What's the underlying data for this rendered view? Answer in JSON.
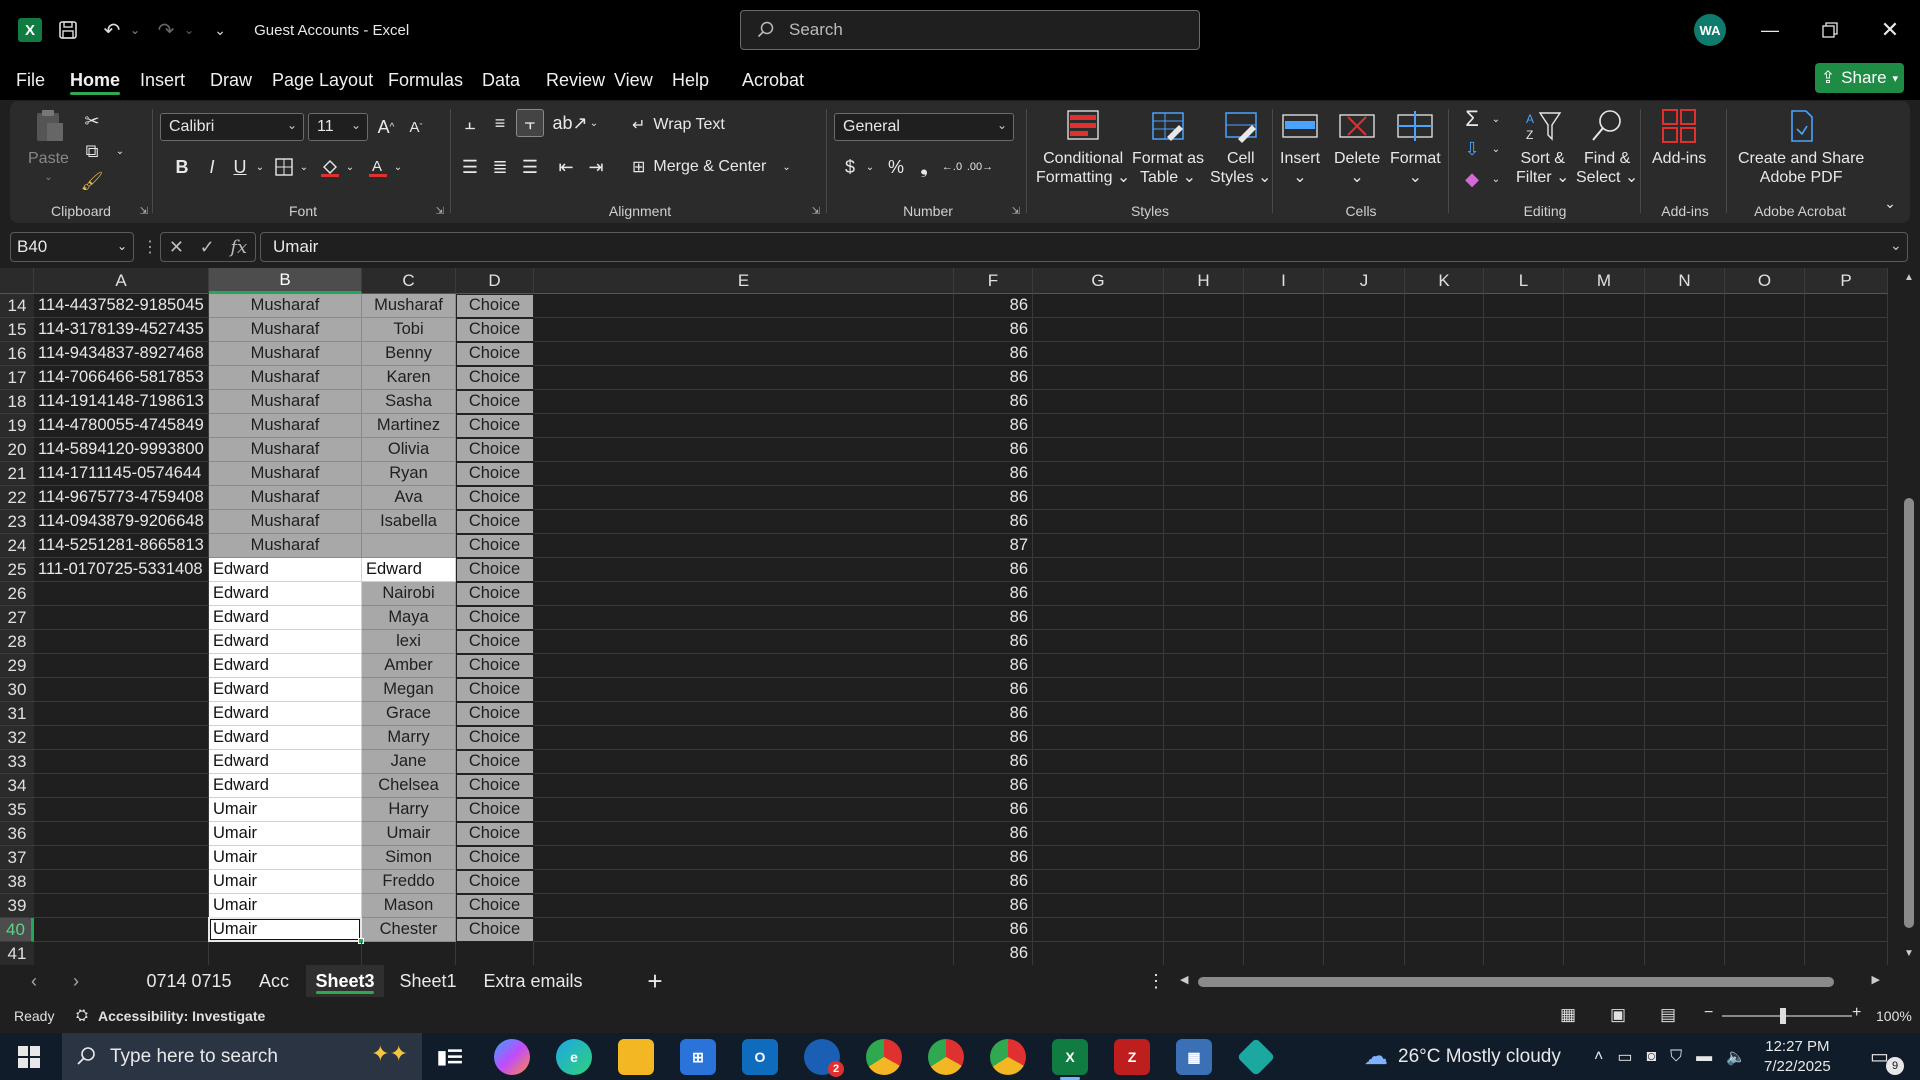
{
  "window": {
    "app": "Excel",
    "title": "Guest Accounts - Excel",
    "search_placeholder": "Search",
    "user_initials": "WA"
  },
  "menu": {
    "items": [
      "File",
      "Home",
      "Insert",
      "Draw",
      "Page Layout",
      "Formulas",
      "Data",
      "Review",
      "View",
      "Help",
      "Acrobat"
    ],
    "active": "Home",
    "share_label": "Share"
  },
  "ribbon": {
    "clipboard": {
      "label": "Clipboard",
      "paste": "Paste"
    },
    "font": {
      "label": "Font",
      "font_name": "Calibri",
      "font_size": "11"
    },
    "alignment": {
      "label": "Alignment",
      "wrap_text": "Wrap Text",
      "merge_center": "Merge & Center"
    },
    "number": {
      "label": "Number",
      "format": "General"
    },
    "styles": {
      "label": "Styles",
      "conditional_1": "Conditional",
      "conditional_2": "Formatting",
      "format_table_1": "Format as",
      "format_table_2": "Table",
      "cell_styles_1": "Cell",
      "cell_styles_2": "Styles"
    },
    "cells": {
      "label": "Cells",
      "insert": "Insert",
      "delete": "Delete",
      "format": "Format"
    },
    "editing": {
      "label": "Editing",
      "sort_1": "Sort &",
      "sort_2": "Filter",
      "find_1": "Find &",
      "find_2": "Select"
    },
    "addins": {
      "label": "Add-ins",
      "addins_btn": "Add-ins"
    },
    "acrobat": {
      "label": "Adobe Acrobat",
      "create_1": "Create and Share",
      "create_2": "Adobe PDF"
    }
  },
  "formula_bar": {
    "name_box": "B40",
    "content": "Umair"
  },
  "columns": [
    "A",
    "B",
    "C",
    "D",
    "E",
    "F",
    "G",
    "H",
    "I",
    "J",
    "K",
    "L",
    "M",
    "N",
    "O",
    "P"
  ],
  "selected_column": "B",
  "rows": [
    {
      "n": "14",
      "a": "114-4437582-9185045",
      "b": "Musharaf",
      "c": "Musharaf",
      "d": "Choice",
      "f": "86"
    },
    {
      "n": "15",
      "a": "114-3178139-4527435",
      "b": "Musharaf",
      "c": "Tobi",
      "d": "Choice",
      "f": "86"
    },
    {
      "n": "16",
      "a": "114-9434837-8927468",
      "b": "Musharaf",
      "c": "Benny",
      "d": "Choice",
      "f": "86"
    },
    {
      "n": "17",
      "a": "114-7066466-5817853",
      "b": "Musharaf",
      "c": "Karen",
      "d": "Choice",
      "f": "86"
    },
    {
      "n": "18",
      "a": "114-1914148-7198613",
      "b": "Musharaf",
      "c": "Sasha",
      "d": "Choice",
      "f": "86"
    },
    {
      "n": "19",
      "a": "114-4780055-4745849",
      "b": "Musharaf",
      "c": "Martinez",
      "d": "Choice",
      "f": "86"
    },
    {
      "n": "20",
      "a": "114-5894120-9993800",
      "b": "Musharaf",
      "c": "Olivia",
      "d": "Choice",
      "f": "86"
    },
    {
      "n": "21",
      "a": "114-1711145-0574644",
      "b": "Musharaf",
      "c": "Ryan",
      "d": "Choice",
      "f": "86"
    },
    {
      "n": "22",
      "a": "114-9675773-4759408",
      "b": "Musharaf",
      "c": "Ava",
      "d": "Choice",
      "f": "86"
    },
    {
      "n": "23",
      "a": "114-0943879-9206648",
      "b": "Musharaf",
      "c": "Isabella",
      "d": "Choice",
      "f": "86"
    },
    {
      "n": "24",
      "a": "114-5251281-8665813",
      "b": "Musharaf",
      "c": "",
      "d": "Choice",
      "f": "87"
    },
    {
      "n": "25",
      "a": "111-0170725-5331408",
      "b": "Edward",
      "c": "Edward",
      "d": "Choice",
      "f": "86"
    },
    {
      "n": "26",
      "a": "",
      "b": "Edward",
      "c": "Nairobi",
      "d": "Choice",
      "f": "86"
    },
    {
      "n": "27",
      "a": "",
      "b": "Edward",
      "c": "Maya",
      "d": "Choice",
      "f": "86"
    },
    {
      "n": "28",
      "a": "",
      "b": "Edward",
      "c": "lexi",
      "d": "Choice",
      "f": "86"
    },
    {
      "n": "29",
      "a": "",
      "b": "Edward",
      "c": "Amber",
      "d": "Choice",
      "f": "86"
    },
    {
      "n": "30",
      "a": "",
      "b": "Edward",
      "c": "Megan",
      "d": "Choice",
      "f": "86"
    },
    {
      "n": "31",
      "a": "",
      "b": "Edward",
      "c": "Grace",
      "d": "Choice",
      "f": "86"
    },
    {
      "n": "32",
      "a": "",
      "b": "Edward",
      "c": "Marry",
      "d": "Choice",
      "f": "86"
    },
    {
      "n": "33",
      "a": "",
      "b": "Edward",
      "c": "Jane",
      "d": "Choice",
      "f": "86"
    },
    {
      "n": "34",
      "a": "",
      "b": "Edward",
      "c": "Chelsea",
      "d": "Choice",
      "f": "86"
    },
    {
      "n": "35",
      "a": "",
      "b": "Umair",
      "c": "Harry",
      "d": "Choice",
      "f": "86"
    },
    {
      "n": "36",
      "a": "",
      "b": "Umair",
      "c": "Umair",
      "d": "Choice",
      "f": "86"
    },
    {
      "n": "37",
      "a": "",
      "b": "Umair",
      "c": "Simon",
      "d": "Choice",
      "f": "86"
    },
    {
      "n": "38",
      "a": "",
      "b": "Umair",
      "c": "Freddo",
      "d": "Choice",
      "f": "86"
    },
    {
      "n": "39",
      "a": "",
      "b": "Umair",
      "c": "Mason",
      "d": "Choice",
      "f": "86"
    },
    {
      "n": "40",
      "a": "",
      "b": "Umair",
      "c": "Chester",
      "d": "Choice",
      "f": "86"
    },
    {
      "n": "41",
      "a": "",
      "b": "",
      "c": "",
      "d": "",
      "f": "86"
    }
  ],
  "active_row": "40",
  "sheets": {
    "tabs": [
      "0714 0715",
      "Acc",
      "Sheet3",
      "Sheet1",
      "Extra emails"
    ],
    "active": "Sheet3"
  },
  "status": {
    "ready": "Ready",
    "accessibility": "Accessibility: Investigate",
    "zoom": "100%"
  },
  "taskbar": {
    "search_placeholder": "Type here to search",
    "weather": "26°C  Mostly cloudy",
    "time": "12:27 PM",
    "date": "7/22/2025",
    "notification_count": "9",
    "outlook_badge": "2"
  },
  "colors": {
    "excel_green": "#107c41",
    "accent_green": "#22a85a",
    "selection_gray": "#a8a8a8",
    "background": "#1f1f1f"
  }
}
